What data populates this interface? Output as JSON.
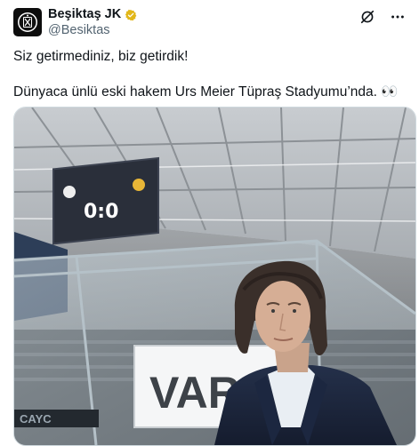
{
  "account": {
    "display_name": "Beşiktaş JK",
    "handle": "@Besiktas",
    "verified": true,
    "verified_color": "#e2b719"
  },
  "tweet": {
    "line1": "Siz getirmediniz, biz getirdik!",
    "line2": "Dünyaca ünlü eski hakem Urs Meier Tüpraş Stadyumu’nda. 👀"
  },
  "media": {
    "scoreboard_text": "0:0",
    "var_text": "VAR",
    "board_text": "CAYC"
  },
  "icons": {
    "more": "more-icon",
    "grok": "grok-icon",
    "verified": "verified-badge-icon"
  },
  "colors": {
    "text_primary": "#0f1419",
    "text_secondary": "#536471",
    "border": "#cfd9de"
  }
}
